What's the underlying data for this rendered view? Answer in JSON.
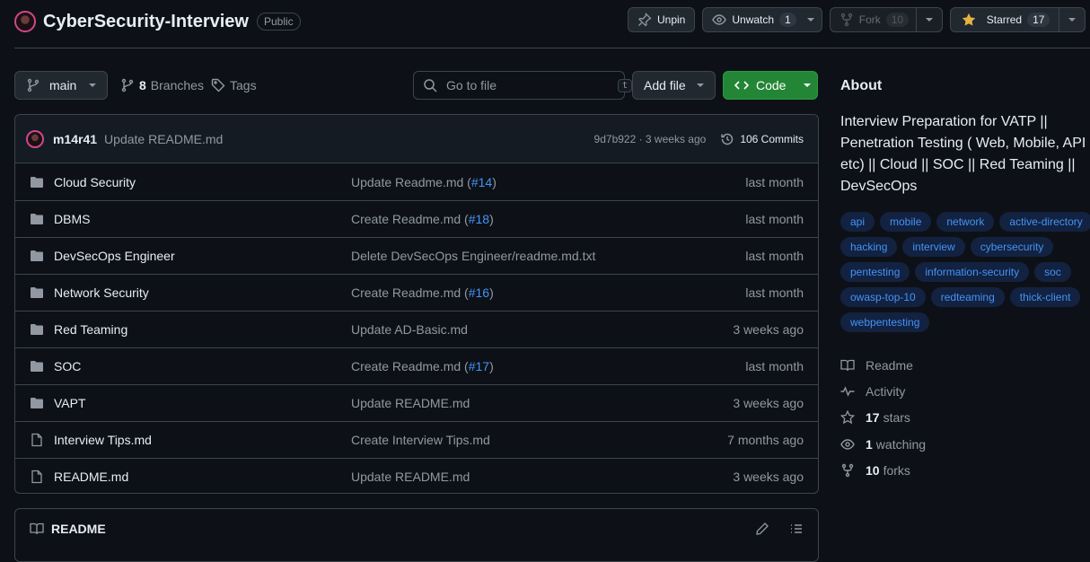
{
  "repo": {
    "owner_avatar": "avatar",
    "name": "CyberSecurity-Interview",
    "visibility": "Public"
  },
  "header_actions": {
    "unpin_label": "Unpin",
    "unwatch_label": "Unwatch",
    "watch_count": "1",
    "fork_label": "Fork",
    "fork_count": "10",
    "starred_label": "Starred",
    "star_count": "17"
  },
  "toolbar": {
    "branch": "main",
    "branches_count": "8",
    "branches_label": "Branches",
    "tags_label": "Tags",
    "goto_placeholder": "Go to file",
    "goto_shortcut": "t",
    "add_file_label": "Add file",
    "code_label": "Code"
  },
  "latest_commit": {
    "author": "m14r41",
    "message": "Update README.md",
    "meta": "9d7b922 · 3 weeks ago",
    "commits_label": "106 Commits"
  },
  "files": [
    {
      "type": "folder",
      "name": "Cloud Security",
      "msg": "Update Readme.md (",
      "pr": "#14",
      "msg_end": ")",
      "ago": "last month"
    },
    {
      "type": "folder",
      "name": "DBMS",
      "msg": "Create Readme.md (",
      "pr": "#18",
      "msg_end": ")",
      "ago": "last month"
    },
    {
      "type": "folder",
      "name": "DevSecOps Engineer",
      "msg": "Delete DevSecOps Engineer/readme.md.txt",
      "pr": "",
      "msg_end": "",
      "ago": "last month"
    },
    {
      "type": "folder",
      "name": "Network Security",
      "msg": "Create Readme.md (",
      "pr": "#16",
      "msg_end": ")",
      "ago": "last month"
    },
    {
      "type": "folder",
      "name": "Red Teaming",
      "msg": "Update AD-Basic.md",
      "pr": "",
      "msg_end": "",
      "ago": "3 weeks ago"
    },
    {
      "type": "folder",
      "name": "SOC",
      "msg": "Create Readme.md (",
      "pr": "#17",
      "msg_end": ")",
      "ago": "last month"
    },
    {
      "type": "folder",
      "name": "VAPT",
      "msg": "Update README.md",
      "pr": "",
      "msg_end": "",
      "ago": "3 weeks ago"
    },
    {
      "type": "file",
      "name": "Interview Tips.md",
      "msg": "Create Interview Tips.md",
      "pr": "",
      "msg_end": "",
      "ago": "7 months ago"
    },
    {
      "type": "file",
      "name": "README.md",
      "msg": "Update README.md",
      "pr": "",
      "msg_end": "",
      "ago": "3 weeks ago"
    }
  ],
  "readme": {
    "title": "README"
  },
  "about": {
    "heading": "About",
    "description": "Interview Preparation for VATP || Penetration Testing ( Web, Mobile, API etc) || Cloud || SOC || Red Teaming || DevSecOps",
    "topics": [
      "api",
      "mobile",
      "network",
      "active-directory",
      "hacking",
      "interview",
      "cybersecurity",
      "pentesting",
      "information-security",
      "soc",
      "owasp-top-10",
      "redteaming",
      "thick-client",
      "webpentesting"
    ],
    "links": {
      "readme": "Readme",
      "activity": "Activity",
      "stars_count": "17",
      "stars_label": "stars",
      "watching_count": "1",
      "watching_label": "watching",
      "forks_count": "10",
      "forks_label": "forks"
    }
  },
  "colors": {
    "background": "#0d1117",
    "accent_link": "#4493f8",
    "code_button": "#238636",
    "star": "#e3b341"
  }
}
